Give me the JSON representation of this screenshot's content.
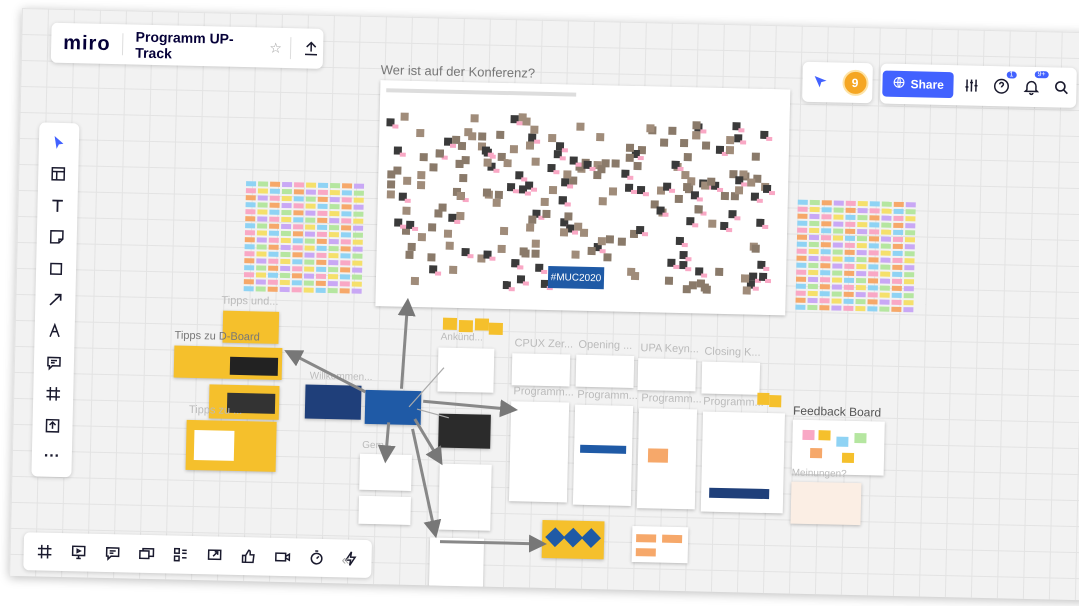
{
  "app": {
    "logo": "miro",
    "board_title": "Programm UP-Track",
    "star_icon": "star-icon",
    "upload_icon": "upload-icon"
  },
  "top_right": {
    "share_label": "Share",
    "help_badge": "1",
    "notif_badge": "9+",
    "avatar_letter": "9"
  },
  "board": {
    "conference_title": "Wer ist auf der Konferenz?",
    "hashtag": "#MUC2020",
    "labels": {
      "tipps_und": "Tipps und...",
      "tipps_zu_d": "Tipps zu D-Board",
      "tipps_zu": "Tipps zu ...",
      "willkommen": "Willkommen...",
      "gemeinsam": "Gem...",
      "ankuend": "Ankünd...",
      "cpux": "CPUX Zer...",
      "opening": "Opening ...",
      "upa_keyn": "UPA Keyn...",
      "closing": "Closing K...",
      "programm1": "Programm...",
      "programm2": "Programm...",
      "programm3": "Programm...",
      "programm4": "Programm...",
      "feedback": "Feedback Board",
      "meinungen": "Meinungen?"
    }
  },
  "left_toolbar": [
    {
      "name": "select-tool",
      "icon": "cursor-icon"
    },
    {
      "name": "templates-tool",
      "icon": "template-icon"
    },
    {
      "name": "text-tool",
      "icon": "text-icon"
    },
    {
      "name": "sticky-note-tool",
      "icon": "sticky-note-icon"
    },
    {
      "name": "shape-tool",
      "icon": "square-icon"
    },
    {
      "name": "arrow-tool",
      "icon": "arrow-icon"
    },
    {
      "name": "pen-tool",
      "icon": "pen-icon"
    },
    {
      "name": "comment-tool",
      "icon": "comment-icon"
    },
    {
      "name": "frame-tool",
      "icon": "frame-icon"
    },
    {
      "name": "upload-tool",
      "icon": "upload-icon"
    },
    {
      "name": "more-tools",
      "icon": "more-icon"
    }
  ],
  "bottom_toolbar": [
    {
      "name": "frames-panel",
      "icon": "frame-icon"
    },
    {
      "name": "presentation",
      "icon": "presentation-icon"
    },
    {
      "name": "comments",
      "icon": "comment-icon"
    },
    {
      "name": "cards",
      "icon": "cards-icon"
    },
    {
      "name": "kanban",
      "icon": "kanban-icon"
    },
    {
      "name": "screen-share",
      "icon": "screen-share-icon"
    },
    {
      "name": "voting",
      "icon": "thumbs-up-icon"
    },
    {
      "name": "video-call",
      "icon": "video-icon"
    },
    {
      "name": "timer",
      "icon": "timer-icon"
    },
    {
      "name": "apps",
      "icon": "lightning-icon"
    }
  ],
  "collapse_label": "«",
  "colors": {
    "brand_blue": "#4262ff",
    "yellow": "#f5c02c",
    "navy": "#1f3f7a",
    "sticky_colors": [
      "#f9a8c5",
      "#f5e06b",
      "#8fd3f4",
      "#b5e6a0",
      "#f6a86a",
      "#c9a8f5"
    ]
  }
}
